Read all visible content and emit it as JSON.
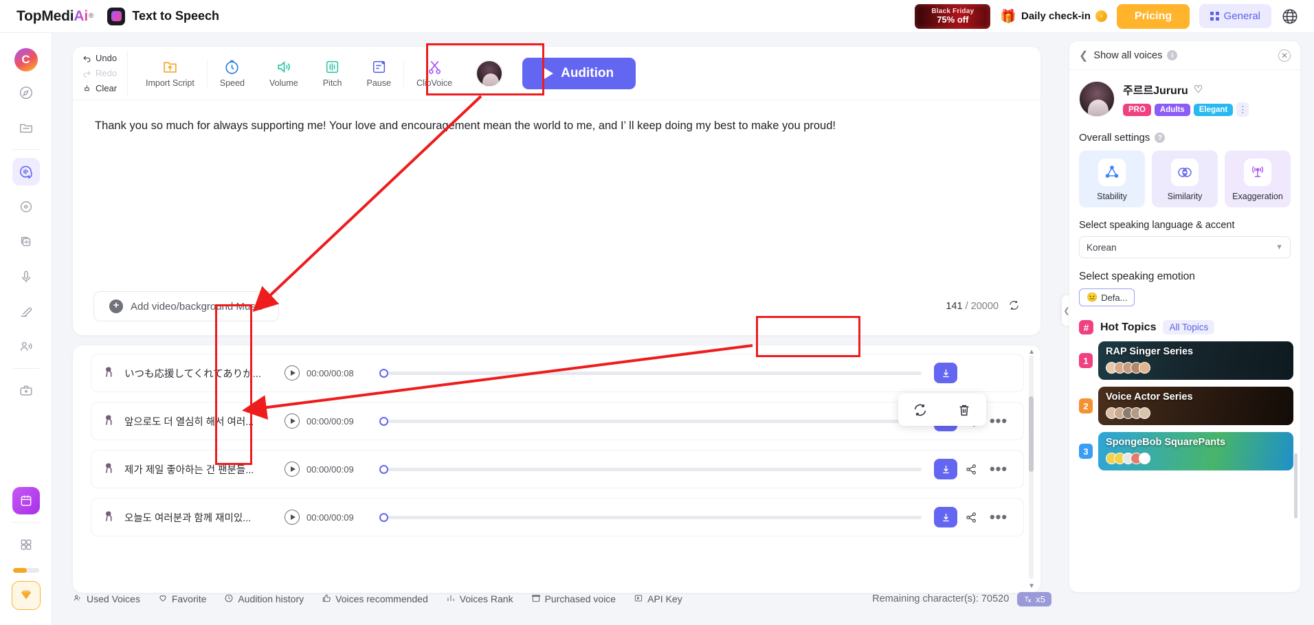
{
  "header": {
    "brand": "TopMedi",
    "brand_ai": "Ai",
    "brand_reg": "®",
    "app_title": "Text to Speech",
    "black_friday_line1": "Black Friday",
    "black_friday_line2": "75% off",
    "daily_checkin": "Daily check-in",
    "coin_glyph": "›",
    "pricing": "Pricing",
    "general": "General",
    "globe_icon": "globe-icon"
  },
  "rail": {
    "avatar_letter": "C",
    "items": [
      {
        "name": "explore-icon",
        "label": "Explore"
      },
      {
        "name": "folder-icon",
        "label": "My Files"
      },
      {
        "name": "text-to-speech-icon",
        "label": "Text to Speech"
      },
      {
        "name": "voice-changer-icon",
        "label": "Voice Changer"
      },
      {
        "name": "voice-cloning-icon",
        "label": "Voice Cloning"
      },
      {
        "name": "microphone-icon",
        "label": "AI Recorder"
      },
      {
        "name": "pen-mic-icon",
        "label": "Voice Editor"
      },
      {
        "name": "speaker-person-icon",
        "label": "Speakers"
      },
      {
        "name": "briefcase-icon",
        "label": "Workspace"
      }
    ],
    "calendar_badge": "calendar-icon",
    "apps_icon": "apps-grid-icon",
    "vip_icon": "vip-diamond-icon"
  },
  "toolbar": {
    "undo": "Undo",
    "redo": "Redo",
    "clear": "Clear",
    "tools": [
      {
        "label": "Import Script",
        "icon": "import-script-icon"
      },
      {
        "label": "Speed",
        "icon": "speed-icon"
      },
      {
        "label": "Volume",
        "icon": "volume-icon"
      },
      {
        "label": "Pitch",
        "icon": "pitch-icon"
      },
      {
        "label": "Pause",
        "icon": "pause-icon"
      },
      {
        "label": "ClipVoice",
        "icon": "scissors-icon"
      }
    ],
    "audition": "Audition"
  },
  "editor": {
    "script_text": "Thank you so much for always supporting me! Your love and encouragement mean the world to me, and I’  ll keep doing my best to make you proud!",
    "add_media": "Add video/background Music",
    "char_count": "141",
    "char_sep": "/",
    "char_limit": "20000",
    "refresh_icon": "refresh-icon"
  },
  "audio_list": {
    "rows": [
      {
        "title": "いつも応援してくれてありが...",
        "time": "00:00/00:08",
        "download": "download-icon",
        "share": "share-icon",
        "more": "•••"
      },
      {
        "title": "앞으로도 더 열심히 해서 여러...",
        "time": "00:00/00:09",
        "download": "download-icon",
        "share": "share-icon",
        "more": "•••"
      },
      {
        "title": "제가 제일 좋아하는 건 팬분들...",
        "time": "00:00/00:09",
        "download": "download-icon",
        "share": "share-icon",
        "more": "•••"
      },
      {
        "title": "오늘도 여러분과 함께 재미있...",
        "time": "00:00/00:09",
        "download": "download-icon",
        "share": "share-icon",
        "more": "•••"
      }
    ],
    "popup": {
      "regenerate_icon": "regenerate-icon",
      "delete_icon": "trash-icon"
    }
  },
  "bottom_bar": {
    "items": [
      {
        "label": "Used Voices",
        "icon": "used-voices-icon"
      },
      {
        "label": "Favorite",
        "icon": "heart-icon"
      },
      {
        "label": "Audition history",
        "icon": "clock-icon"
      },
      {
        "label": "Voices recommended",
        "icon": "thumbs-up-icon"
      },
      {
        "label": "Voices Rank",
        "icon": "bar-chart-icon"
      },
      {
        "label": "Purchased voice",
        "icon": "box-icon"
      },
      {
        "label": "API Key",
        "icon": "api-key-icon"
      }
    ],
    "remaining": "Remaining character(s): 70520",
    "multiplier": "x5"
  },
  "right_panel": {
    "back_label": "Show all voices",
    "info_icon": "info-icon",
    "close_icon": "close-icon",
    "voice_name": "주르르Jururu",
    "favorite_icon": "heart-outline-icon",
    "tags": [
      {
        "label": "PRO",
        "color": "#f0407f"
      },
      {
        "label": "Adults",
        "color": "#8b5cf6"
      },
      {
        "label": "Elegant",
        "color": "#27b9ef"
      }
    ],
    "more_icon": "more-vertical-icon",
    "overall_settings": "Overall settings",
    "settings": [
      {
        "label": "Stability",
        "icon": "stability-icon"
      },
      {
        "label": "Similarity",
        "icon": "similarity-icon"
      },
      {
        "label": "Exaggeration",
        "icon": "exaggeration-icon"
      }
    ],
    "language_label": "Select speaking language & accent",
    "language_value": "Korean",
    "emotion_label": "Select speaking emotion",
    "emotion_value": "Defa...",
    "emotion_emoji": "😐",
    "hot_topics_title": "Hot Topics",
    "all_topics": "All Topics",
    "topics": [
      {
        "rank": "1",
        "title": "RAP Singer Series"
      },
      {
        "rank": "2",
        "title": "Voice Actor Series"
      },
      {
        "rank": "3",
        "title": "SpongeBob SquarePants"
      }
    ]
  },
  "colors": {
    "accent": "#6366f1",
    "pricing": "#ffb42b",
    "annotation": "#ee1c1c",
    "pro_tag": "#f0407f"
  }
}
